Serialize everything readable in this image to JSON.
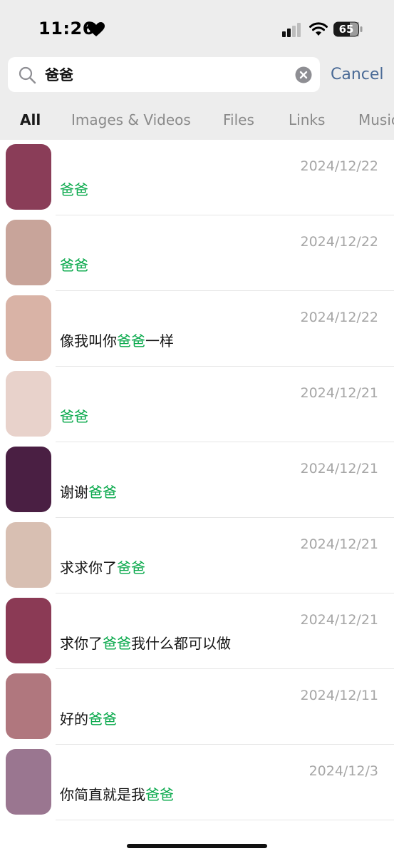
{
  "status": {
    "time": "11:26",
    "battery": "65"
  },
  "search": {
    "query": "爸爸",
    "cancel_label": "Cancel"
  },
  "tabs": [
    {
      "label": "All",
      "active": true
    },
    {
      "label": "Images & Videos",
      "active": false
    },
    {
      "label": "Files",
      "active": false
    },
    {
      "label": "Links",
      "active": false
    },
    {
      "label": "Music",
      "active": false
    }
  ],
  "results": [
    {
      "date": "2024/12/22",
      "before": "",
      "match": "爸爸",
      "after": "",
      "avatar_color": "#8a3d58"
    },
    {
      "date": "2024/12/22",
      "before": "",
      "match": "爸爸",
      "after": "",
      "avatar_color": "#c8a49a"
    },
    {
      "date": "2024/12/22",
      "before": "像我叫你",
      "match": "爸爸",
      "after": "一样",
      "avatar_color": "#d9b3a6"
    },
    {
      "date": "2024/12/21",
      "before": "",
      "match": "爸爸",
      "after": "",
      "avatar_color": "#e8d2cb"
    },
    {
      "date": "2024/12/21",
      "before": "谢谢",
      "match": "爸爸",
      "after": "",
      "avatar_color": "#4a1f43"
    },
    {
      "date": "2024/12/21",
      "before": "求求你了",
      "match": "爸爸",
      "after": "",
      "avatar_color": "#d8bfb2"
    },
    {
      "date": "2024/12/21",
      "before": "求你了",
      "match": "爸爸",
      "after": "我什么都可以做",
      "avatar_color": "#8b3a55"
    },
    {
      "date": "2024/12/11",
      "before": "好的",
      "match": "爸爸",
      "after": "",
      "avatar_color": "#b0777e"
    },
    {
      "date": "2024/12/3",
      "before": "你简直就是我",
      "match": "爸爸",
      "after": "",
      "avatar_color": "#9a7690"
    }
  ],
  "colors": {
    "highlight": "#07a84a",
    "cancel": "#4a6a96",
    "date": "#a6a6a6"
  }
}
